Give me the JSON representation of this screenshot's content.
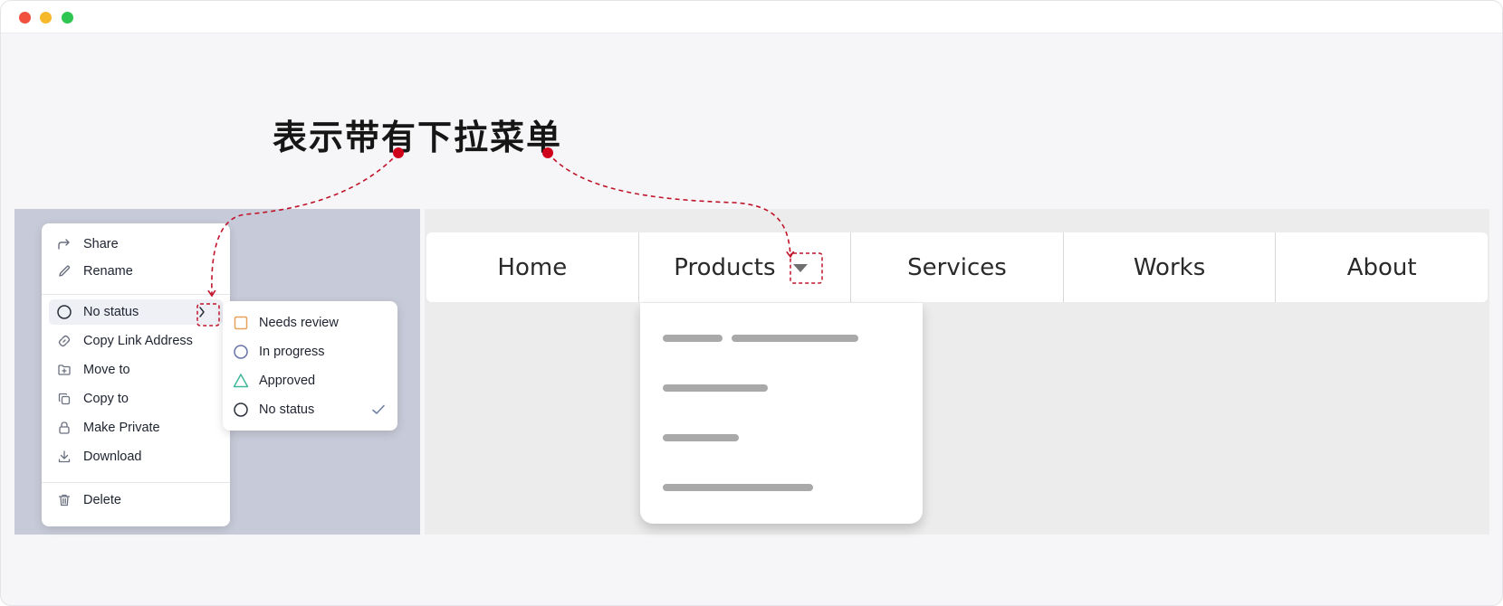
{
  "window": {
    "controls": [
      "close",
      "minimize",
      "maximize"
    ],
    "colors": {
      "close": "#f0503d",
      "minimize": "#f6b92b",
      "maximize": "#2fc551"
    }
  },
  "annotation": {
    "text": "表示带有下拉菜单",
    "marker_color": "#d0021b"
  },
  "context_menu": {
    "items": [
      {
        "label": "Share",
        "icon": "share-icon"
      },
      {
        "label": "Rename",
        "icon": "pencil-icon"
      },
      {
        "label": "No status",
        "icon": "circle-icon",
        "has_submenu": true
      },
      {
        "label": "Copy Link Address",
        "icon": "link-icon"
      },
      {
        "label": "Move to",
        "icon": "folder-plus-icon"
      },
      {
        "label": "Copy to",
        "icon": "copy-icon"
      },
      {
        "label": "Make Private",
        "icon": "lock-icon"
      },
      {
        "label": "Download",
        "icon": "download-icon"
      },
      {
        "label": "Delete",
        "icon": "trash-icon"
      }
    ]
  },
  "status_submenu": {
    "items": [
      {
        "label": "Needs review",
        "icon": "square-icon",
        "color": "#e8a15a"
      },
      {
        "label": "In progress",
        "icon": "circle-icon",
        "color": "#6673a8"
      },
      {
        "label": "Approved",
        "icon": "triangle-icon",
        "color": "#3fb89a"
      },
      {
        "label": "No status",
        "icon": "circle-icon",
        "color": "#2a2f3a",
        "selected": true
      }
    ],
    "check_color": "#6f7fa6"
  },
  "navbar": {
    "items": [
      {
        "label": "Home"
      },
      {
        "label": "Products",
        "has_dropdown": true
      },
      {
        "label": "Services"
      },
      {
        "label": "Works"
      },
      {
        "label": "About"
      }
    ]
  },
  "products_dropdown": {
    "placeholder_rows": 4,
    "bar_color": "#a9a9a9"
  }
}
